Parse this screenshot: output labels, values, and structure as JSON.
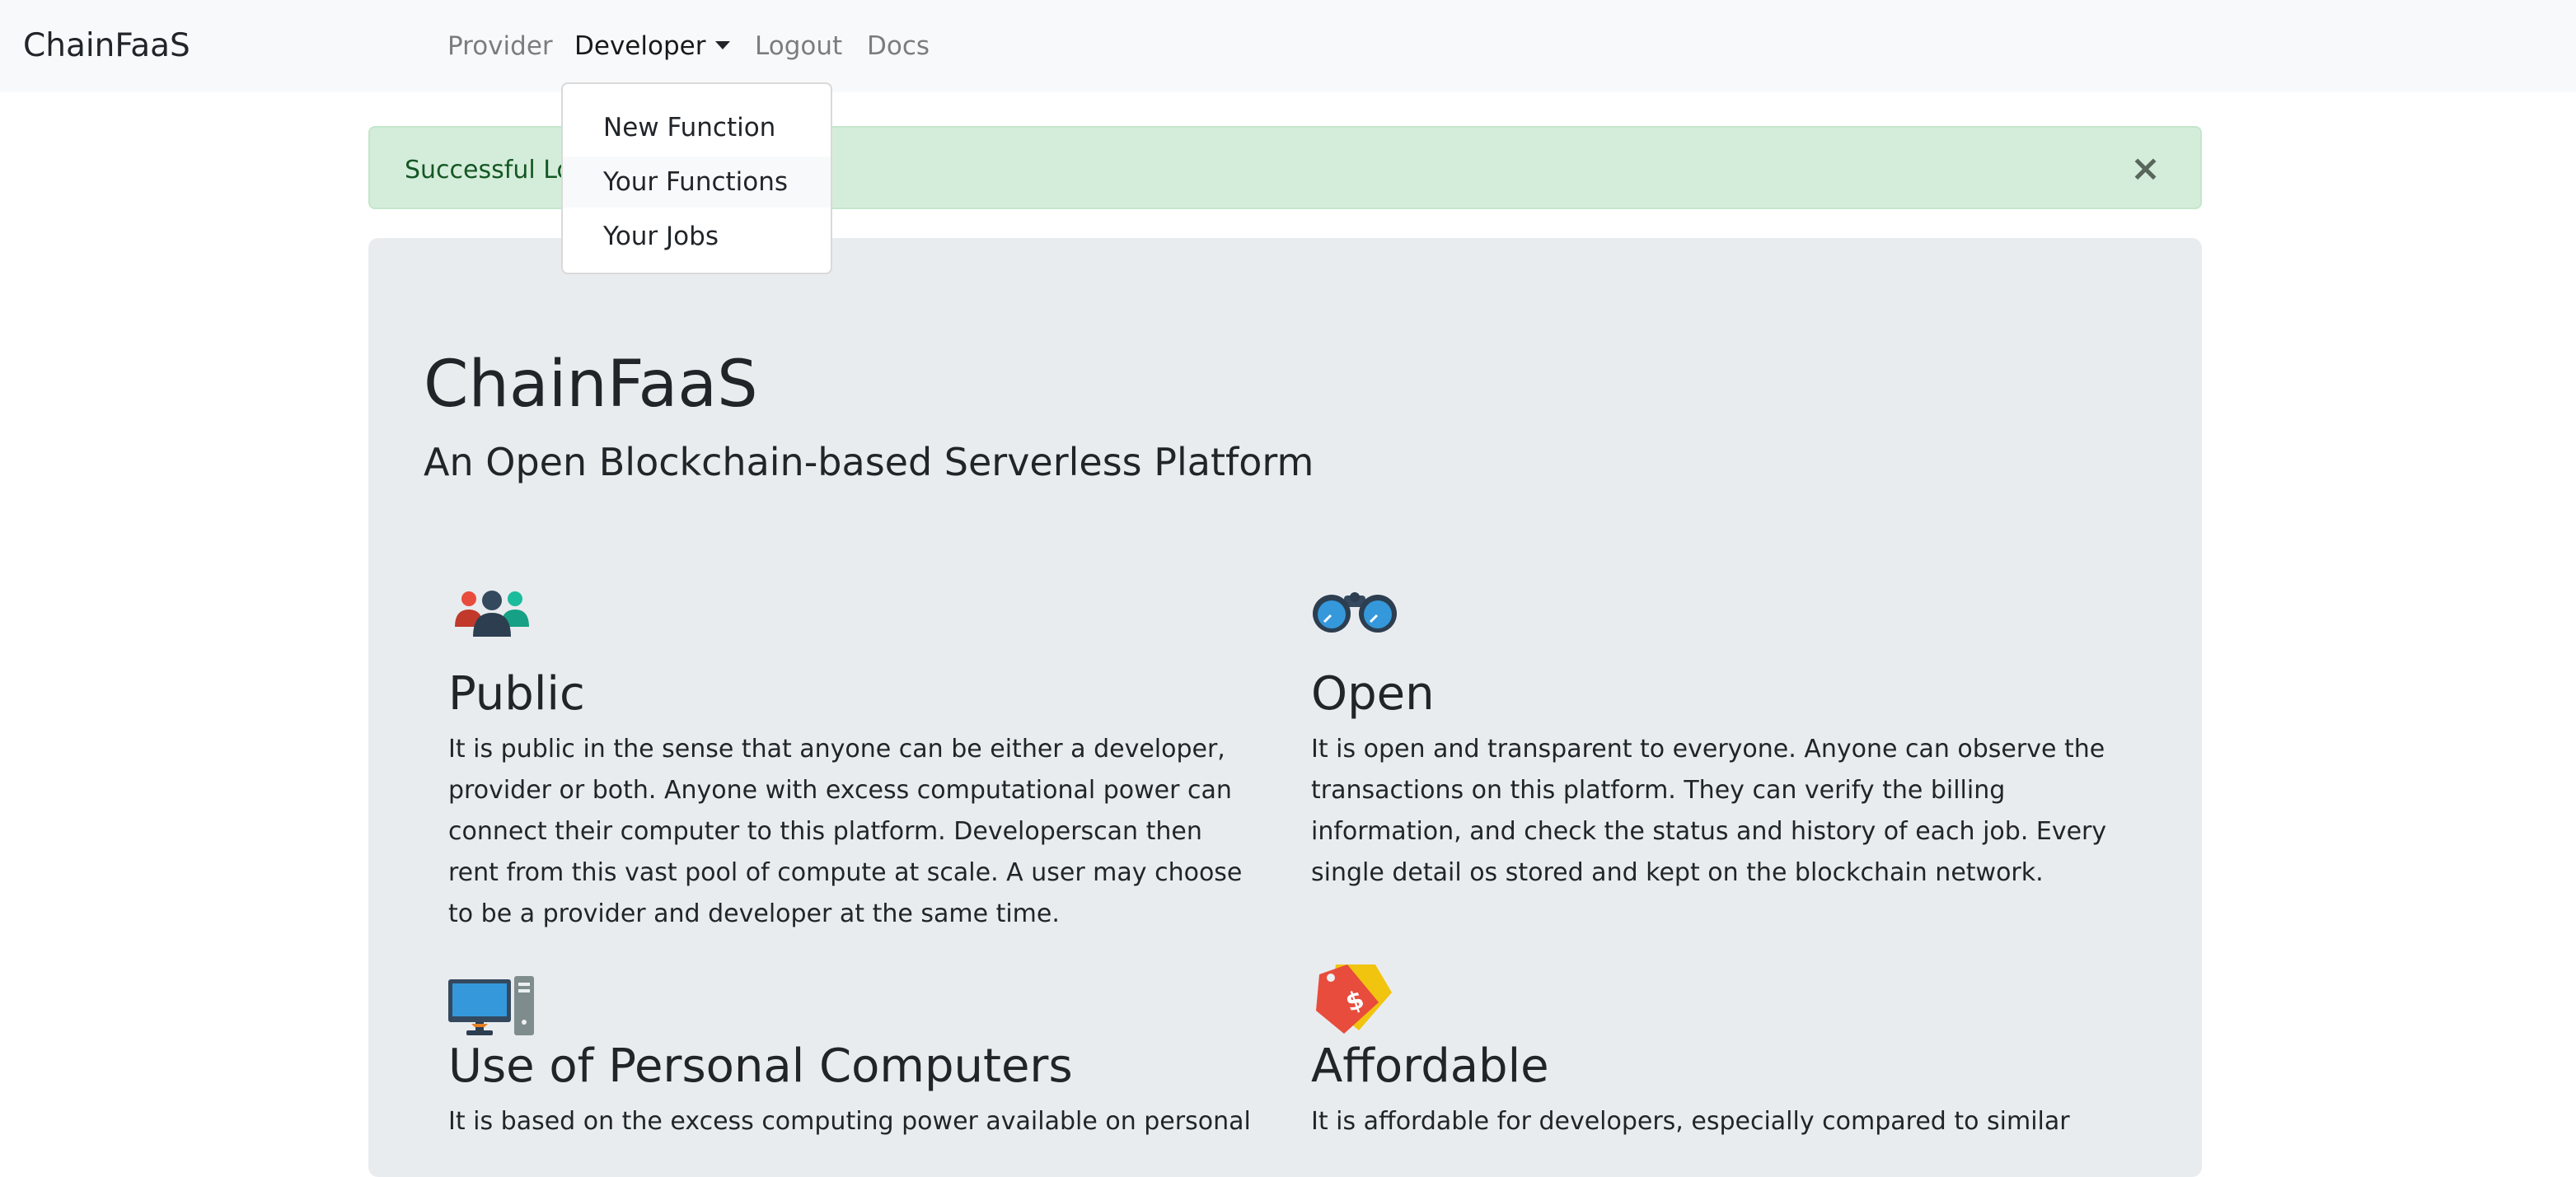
{
  "navbar": {
    "brand": "ChainFaaS",
    "links": [
      {
        "label": "Provider"
      },
      {
        "label": "Developer"
      },
      {
        "label": "Logout"
      },
      {
        "label": "Docs"
      }
    ]
  },
  "dropdown": {
    "items": [
      {
        "label": "New Function"
      },
      {
        "label": "Your Functions"
      },
      {
        "label": "Your Jobs"
      }
    ]
  },
  "alert": {
    "visible_text": "Successful Lo",
    "close_glyph": "×"
  },
  "hero": {
    "title": "ChainFaaS",
    "subtitle": "An Open Blockchain-based Serverless Platform"
  },
  "features": [
    {
      "icon": "people-group-icon",
      "title": "Public",
      "text": "It is public in the sense that anyone can be either a developer, provider or both. Anyone with excess computational power can connect their computer to this platform. Developerscan then rent from this vast pool of compute at scale. A user may choose to be a provider and developer at the same time."
    },
    {
      "icon": "binoculars-icon",
      "title": "Open",
      "text": "It is open and transparent to everyone. Anyone can observe the transactions on this platform. They can verify the billing information, and check the status and history of each job. Every single detail os stored and kept on the blockchain network."
    },
    {
      "icon": "desktop-computer-icon",
      "title": "Use of Personal Computers",
      "text": "It is based on the excess computing power available on personal"
    },
    {
      "icon": "price-tag-icon",
      "title": "Affordable",
      "text": "It is affordable for developers, especially compared to similar"
    }
  ],
  "colors": {
    "navbar_bg": "#f8f9fa",
    "alert_bg": "#d4edda",
    "alert_text": "#155724",
    "jumbotron_bg": "#e9ecef"
  }
}
